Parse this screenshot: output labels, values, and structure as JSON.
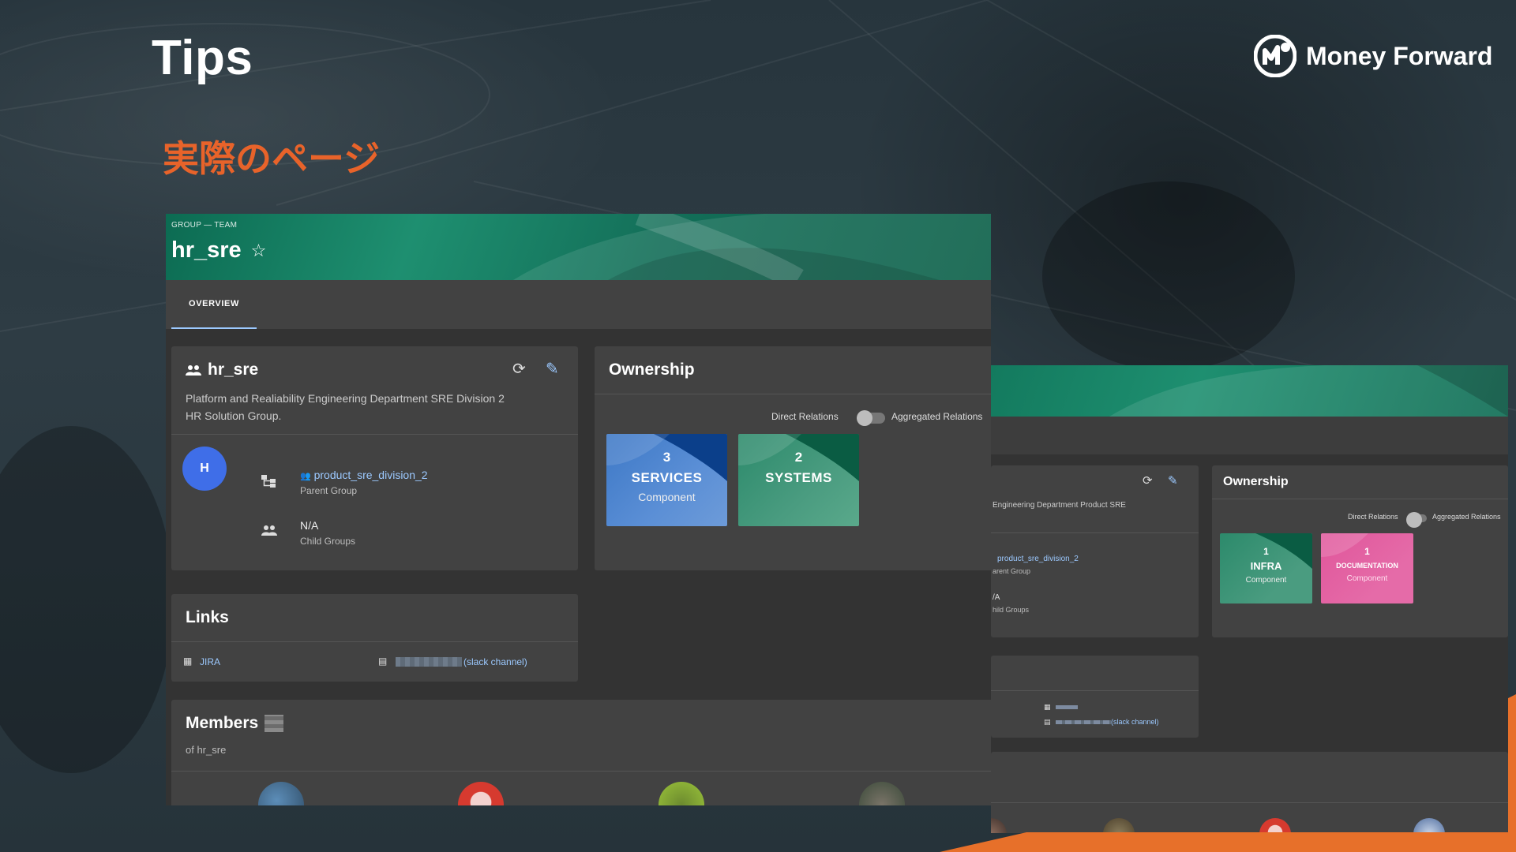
{
  "slide": {
    "title": "Tips",
    "subtitle": "実際のページ",
    "brand": "Money Forward"
  },
  "page": {
    "kind": "GROUP — TEAM",
    "title": "hr_sre",
    "tabs": [
      {
        "label": "OVERVIEW"
      }
    ]
  },
  "group_card": {
    "title": "hr_sre",
    "description": "Platform and Realiability Engineering Department SRE Division 2 HR Solution Group.",
    "avatar_letter": "H",
    "parent_group": {
      "value": "product_sre_division_2",
      "label": "Parent Group"
    },
    "child_groups": {
      "value": "N/A",
      "label": "Child Groups"
    }
  },
  "ownership": {
    "title": "Ownership",
    "toggle_left": "Direct Relations",
    "toggle_right": "Aggregated Relations",
    "tiles": [
      {
        "count": "3",
        "name": "SERVICES",
        "kind": "Component"
      },
      {
        "count": "2",
        "name": "SYSTEMS",
        "kind": ""
      }
    ]
  },
  "links": {
    "title": "Links",
    "items": [
      {
        "label": "JIRA"
      },
      {
        "label": "(slack channel)"
      }
    ]
  },
  "members": {
    "title": "Members",
    "subtitle": "of hr_sre"
  },
  "second_page": {
    "description_fragment": "Engineering Department Product SRE",
    "parent_group": {
      "value": "product_sre_division_2",
      "label": "arent Group"
    },
    "child_groups": {
      "value": "/A",
      "label": "hild Groups"
    },
    "link_label": "(slack channel)",
    "ownership": {
      "title": "Ownership",
      "toggle_left": "Direct Relations",
      "toggle_right": "Aggregated Relations",
      "tiles": [
        {
          "count": "1",
          "name": "INFRA",
          "kind": "Component"
        },
        {
          "count": "1",
          "name": "DOCUMENTATION",
          "kind": "Component"
        }
      ]
    }
  },
  "colors": {
    "accent_orange": "#e8632a",
    "header_green": "#0c6b52",
    "tile_blue": "#4a7fc1",
    "tile_green": "#2e8c6d",
    "tile_pink": "#e0569b",
    "link_blue": "#9cc9ff"
  }
}
